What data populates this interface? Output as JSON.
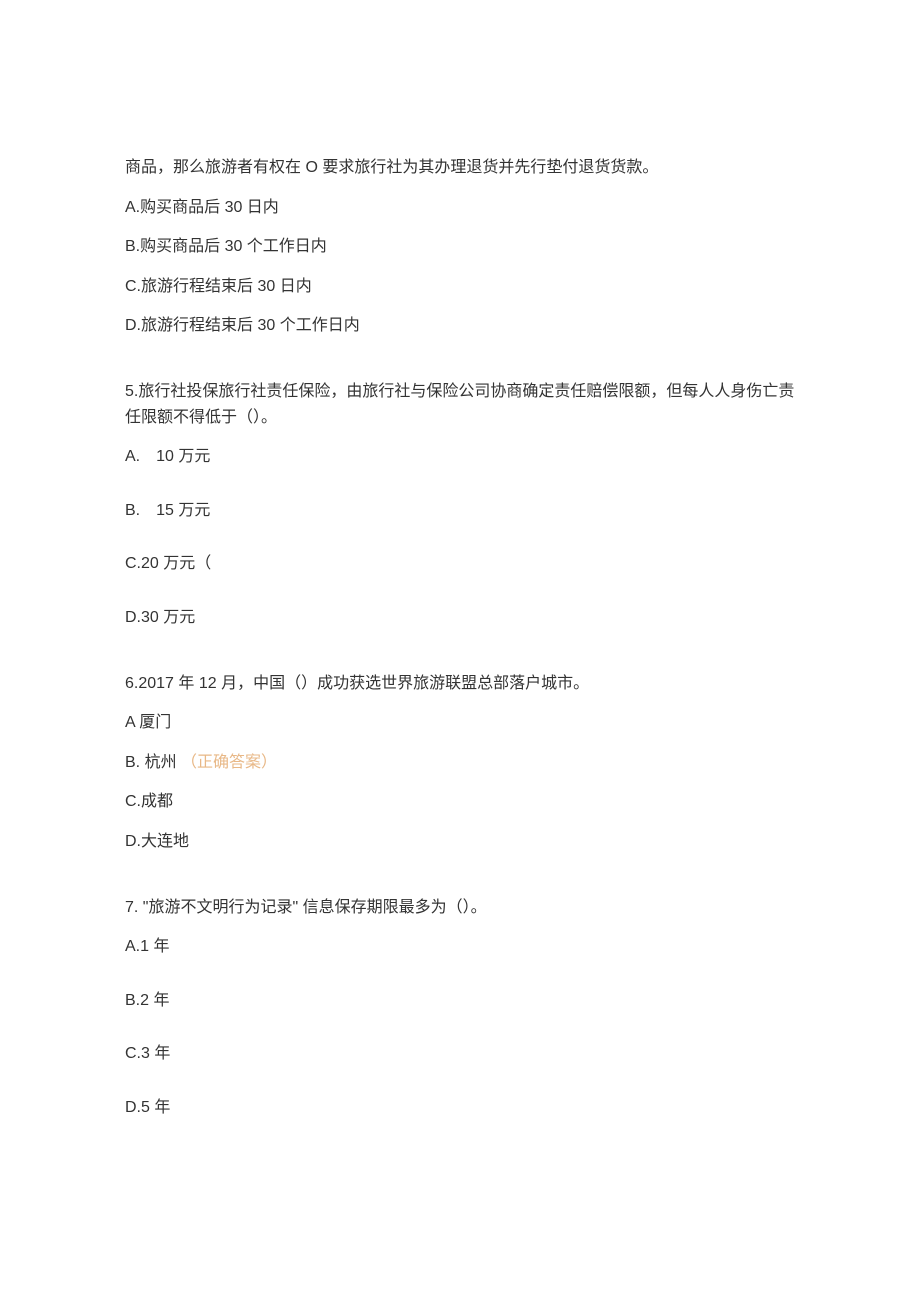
{
  "q4": {
    "text": "商品，那么旅游者有权在 O 要求旅行社为其办理退货并先行垫付退货货款。",
    "optionA": "A.购买商品后 30 日内",
    "optionB": "B.购买商品后 30 个工作日内",
    "optionC": "C.旅游行程结束后 30 日内",
    "optionD": "D.旅游行程结束后 30 个工作日内"
  },
  "q5": {
    "text": "5.旅行社投保旅行社责任保险，由旅行社与保险公司协商确定责任赔偿限额，但每人人身伤亡责任限额不得低于（）。",
    "optionA": "A.　10 万元",
    "optionB": "B.　15 万元",
    "optionC": "C.20 万元（",
    "optionD": "D.30 万元"
  },
  "q6": {
    "text": "6.2017 年 12 月，中国（）成功获选世界旅游联盟总部落户城市。",
    "optionA": "A 厦门",
    "optionB": "B. 杭州",
    "optionB_correct": "（正确答案）",
    "optionC": "C.成都",
    "optionD": "D.大连地"
  },
  "q7": {
    "text": "7. \"旅游不文明行为记录\" 信息保存期限最多为（）。",
    "optionA": "A.1 年",
    "optionB": "B.2 年",
    "optionC": "C.3 年",
    "optionD": "D.5 年"
  }
}
